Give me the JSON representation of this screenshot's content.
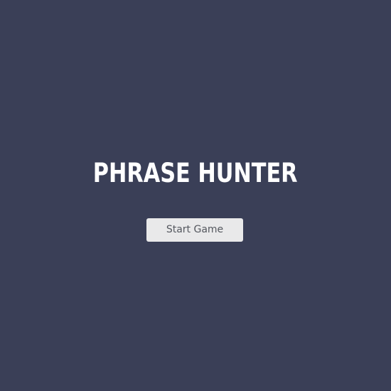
{
  "overlay": {
    "title": "PHRASE HUNTER",
    "start_button_label": "Start Game"
  },
  "colors": {
    "background": "#3a3f57",
    "title_text": "#ffffff",
    "button_background": "#e9e9ea",
    "button_text": "#55585f"
  }
}
